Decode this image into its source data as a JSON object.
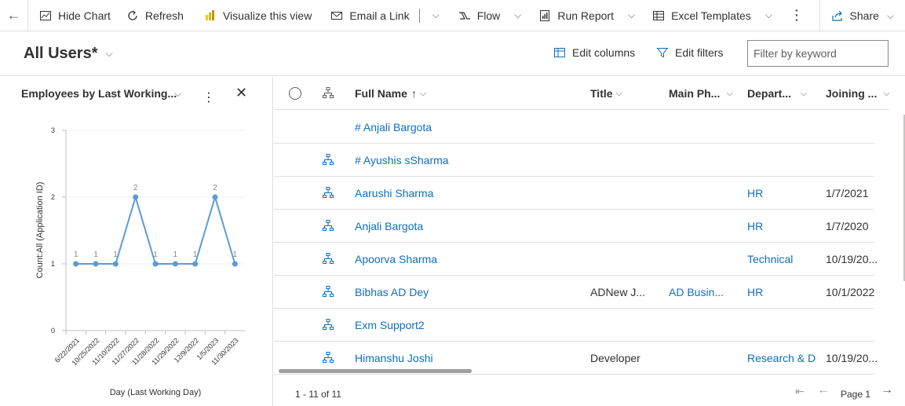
{
  "toolbar": {
    "hide_chart": "Hide Chart",
    "refresh": "Refresh",
    "visualize": "Visualize this view",
    "email_link": "Email a Link",
    "flow": "Flow",
    "run_report": "Run Report",
    "excel_templates": "Excel Templates",
    "share": "Share"
  },
  "view": {
    "title": "All Users*",
    "edit_columns": "Edit columns",
    "edit_filters": "Edit filters",
    "filter_placeholder": "Filter by keyword"
  },
  "chart": {
    "panel_title": "Employees by Last Working...",
    "chart_data": {
      "type": "line",
      "categories": [
        "6/22/2021",
        "10/25/2022",
        "11/10/2022",
        "11/27/2022",
        "11/28/2022",
        "11/29/2022",
        "12/9/2022",
        "1/5/2023",
        "11/30/2023"
      ],
      "values": [
        1,
        1,
        1,
        2,
        1,
        1,
        1,
        2,
        1
      ],
      "xlabel": "Day (Last Working Day)",
      "ylabel": "Count:All (Application ID)",
      "ylim": [
        0,
        3
      ],
      "yticks": [
        "0",
        "1",
        "2",
        "3"
      ],
      "color": "#5b9bd5"
    }
  },
  "grid": {
    "columns": [
      {
        "label": "Full Name",
        "sort": "↑"
      },
      {
        "label": "Title"
      },
      {
        "label": "Main Ph..."
      },
      {
        "label": "Depart..."
      },
      {
        "label": "Joining ..."
      }
    ],
    "rows": [
      {
        "name": "# Anjali Bargota",
        "title": "",
        "phone": "",
        "dept": "",
        "joining": "",
        "hier": false
      },
      {
        "name": "# Ayushis  sSharma",
        "title": "",
        "phone": "",
        "dept": "",
        "joining": "",
        "hier": true
      },
      {
        "name": "Aarushi Sharma",
        "title": "",
        "phone": "",
        "dept": "HR",
        "joining": "1/7/2021",
        "hier": true
      },
      {
        "name": "Anjali Bargota",
        "title": "",
        "phone": "",
        "dept": "HR",
        "joining": "1/7/2020",
        "hier": true
      },
      {
        "name": "Apoorva Sharma",
        "title": "",
        "phone": "",
        "dept": "Technical",
        "joining": "10/19/20...",
        "hier": true
      },
      {
        "name": "Bibhas AD Dey",
        "title": "ADNew J...",
        "phone": "AD Busin...",
        "dept": "HR",
        "joining": "10/1/2022",
        "hier": true
      },
      {
        "name": "Exm Support2",
        "title": "",
        "phone": "",
        "dept": "",
        "joining": "",
        "hier": true
      },
      {
        "name": "Himanshu Joshi",
        "title": "Developer",
        "phone": "",
        "dept": "Research & De",
        "joining": "10/19/20...",
        "hier": true
      }
    ],
    "record_count": "1 - 11 of 11",
    "page_label": "Page 1"
  }
}
